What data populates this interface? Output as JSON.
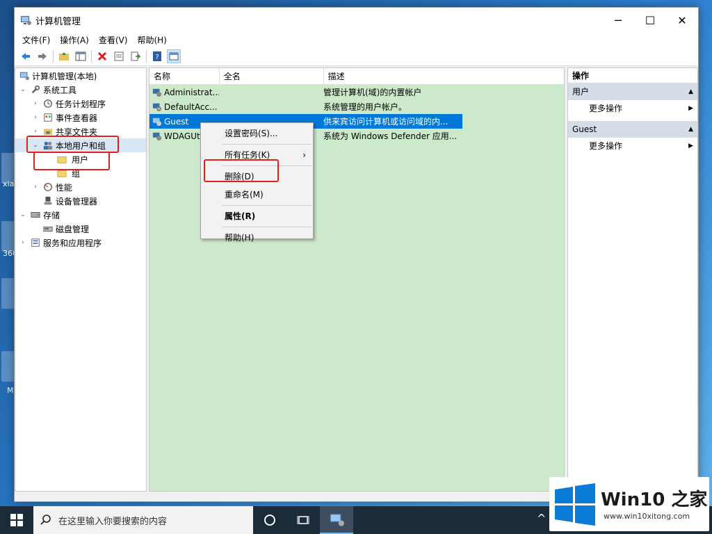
{
  "window": {
    "title": "计算机管理",
    "controls": {
      "minimize": "─",
      "maximize": "☐",
      "close": "✕"
    }
  },
  "menu": [
    "文件(F)",
    "操作(A)",
    "查看(V)",
    "帮助(H)"
  ],
  "toolbar_icons": [
    "back-icon",
    "forward-icon",
    "up-folder-icon",
    "show-tree-icon",
    "delete-icon",
    "properties-icon",
    "export-icon",
    "help-icon",
    "mmc-icon"
  ],
  "tree": {
    "root": "计算机管理(本地)",
    "system_tools": "系统工具",
    "task_scheduler": "任务计划程序",
    "event_viewer": "事件查看器",
    "shared_folders": "共享文件夹",
    "local_users": "本地用户和组",
    "users": "用户",
    "groups": "组",
    "performance": "性能",
    "device_manager": "设备管理器",
    "storage": "存储",
    "disk_management": "磁盘管理",
    "services": "服务和应用程序"
  },
  "list": {
    "columns": [
      "名称",
      "全名",
      "描述"
    ],
    "rows": [
      {
        "name": "Administrat...",
        "fullname": "",
        "desc": "管理计算机(域)的内置帐户"
      },
      {
        "name": "DefaultAcc...",
        "fullname": "",
        "desc": "系统管理的用户帐户。"
      },
      {
        "name": "Guest",
        "fullname": "",
        "desc": "供来宾访问计算机或访问域的内..."
      },
      {
        "name": "WDAGUt",
        "fullname": "",
        "desc": "系统为 Windows Defender 应用..."
      }
    ]
  },
  "context_menu": {
    "set_password": "设置密码(S)...",
    "all_tasks": "所有任务(K)",
    "submenu_arrow": "›",
    "delete": "删除(D)",
    "rename": "重命名(M)",
    "properties": "属性(R)",
    "help": "帮助(H)"
  },
  "actions": {
    "header": "操作",
    "section1": "用户",
    "section1_item": "更多操作",
    "section2": "Guest",
    "section2_item": "更多操作"
  },
  "taskbar": {
    "search_placeholder": "在这里输入你要搜索的内容",
    "chevron": "^"
  },
  "desktop_labels": [
    "xia",
    "360",
    "M"
  ],
  "watermark": {
    "brand": "Win10 之家",
    "url": "www.win10xitong.com"
  },
  "colors": {
    "selection": "#0078d7",
    "list_bg": "#cce9cc",
    "highlight_box": "#e0201a",
    "windows_blue": "#0a7bd6"
  }
}
